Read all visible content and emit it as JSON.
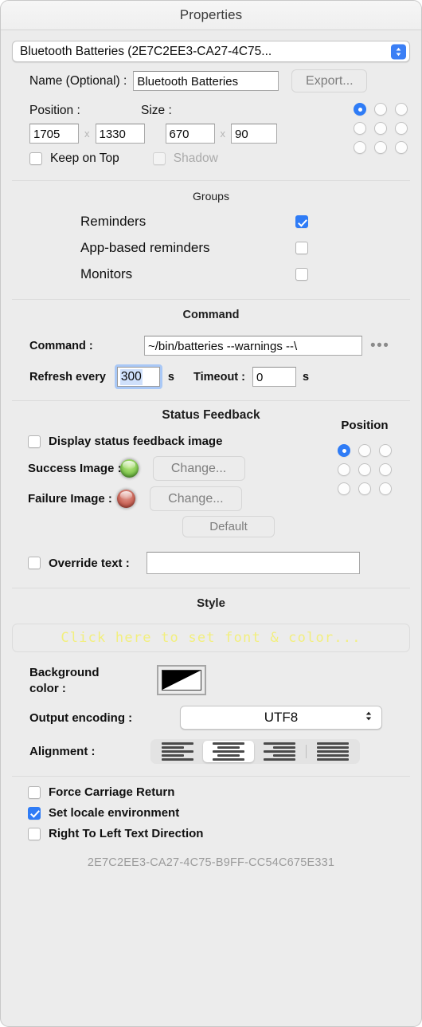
{
  "window": {
    "title": "Properties"
  },
  "geeklet": {
    "selector_value": "Bluetooth Batteries (2E7C2EE3-CA27-4C75...",
    "name_label": "Name (Optional) :",
    "name_value": "Bluetooth Batteries",
    "export_button": "Export..."
  },
  "geometry": {
    "position_label": "Position :",
    "size_label": "Size :",
    "position_x": "1705",
    "position_y": "1330",
    "size_w": "670",
    "size_h": "90",
    "multiplier": "x",
    "keep_on_top_label": "Keep on Top",
    "keep_on_top_checked": false,
    "shadow_label": "Shadow",
    "shadow_checked": false,
    "shadow_disabled": true,
    "anchor_selected_index": 0
  },
  "groups": {
    "title": "Groups",
    "items": [
      {
        "label": "Reminders",
        "checked": true
      },
      {
        "label": "App-based reminders",
        "checked": false
      },
      {
        "label": "Monitors",
        "checked": false
      }
    ]
  },
  "command": {
    "title": "Command",
    "command_label": "Command :",
    "command_value": "~/bin/batteries --warnings --\\",
    "browse_glyph": "•••",
    "refresh_label": "Refresh every",
    "refresh_value": "300",
    "refresh_unit": "s",
    "timeout_label": "Timeout :",
    "timeout_value": "0",
    "timeout_unit": "s"
  },
  "status_feedback": {
    "title": "Status Feedback",
    "display_image_label": "Display status feedback image",
    "display_image_checked": false,
    "success_label": "Success Image :",
    "failure_label": "Failure Image :",
    "success_change_button": "Change...",
    "failure_change_button": "Change...",
    "default_button": "Default",
    "position_label": "Position",
    "position_selected_index": 0,
    "override_label": "Override text :",
    "override_checked": false,
    "override_value": ""
  },
  "style": {
    "title": "Style",
    "font_color_preview": "Click here to set font & color...",
    "font_color_preview_color": "#f2ef7e",
    "background_color_label_line1": "Background",
    "background_color_label_line2": "color :",
    "output_encoding_label": "Output encoding :",
    "output_encoding_value": "UTF8",
    "alignment_label": "Alignment :",
    "alignment_options": [
      "align-left",
      "align-center",
      "align-right",
      "align-justify"
    ],
    "alignment_selected_index": 1
  },
  "options": [
    {
      "label": "Force Carriage Return",
      "checked": false
    },
    {
      "label": "Set locale environment",
      "checked": true
    },
    {
      "label": "Right To Left Text Direction",
      "checked": false
    }
  ],
  "footer": {
    "uuid": "2E7C2EE3-CA27-4C75-B9FF-CC54C675E331"
  },
  "colors": {
    "accent": "#2f7cf6",
    "window_bg": "#ececec"
  }
}
